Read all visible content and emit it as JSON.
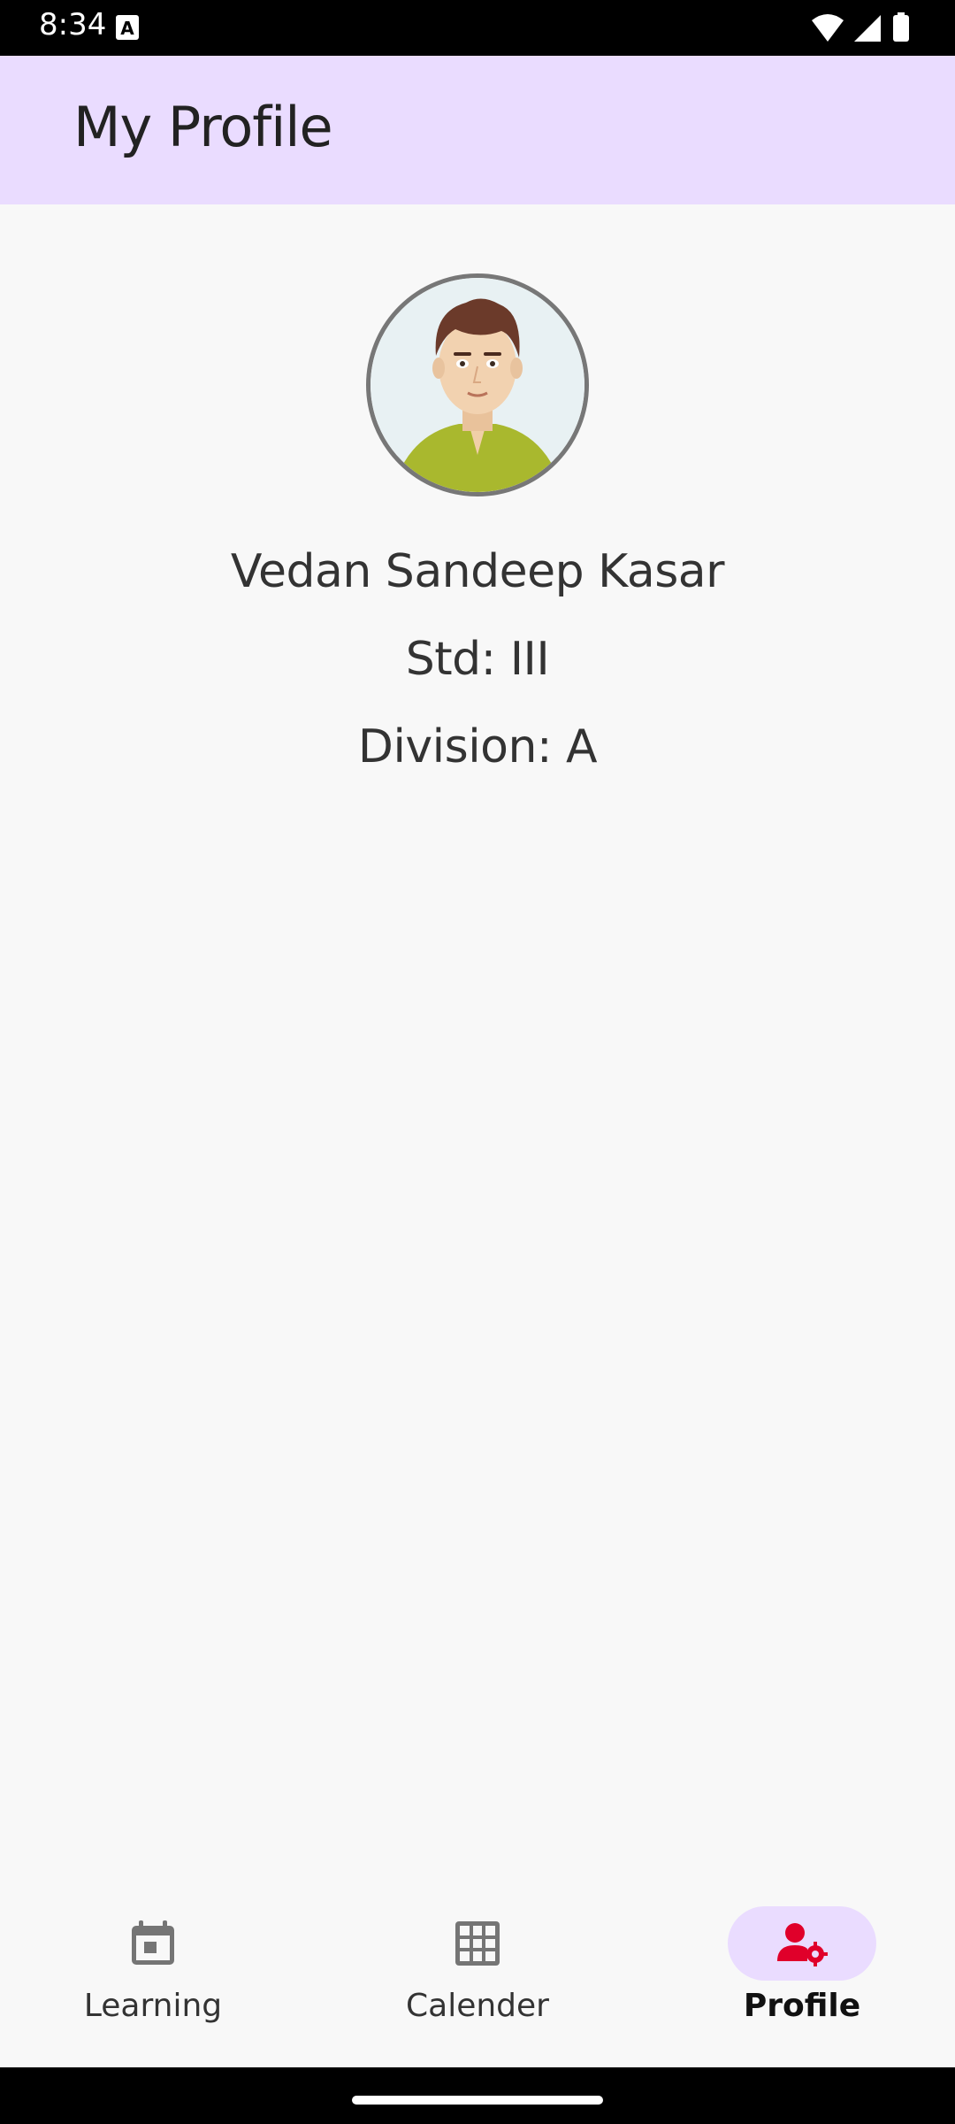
{
  "status_bar": {
    "time": "8:34"
  },
  "app_bar": {
    "title": "My Profile"
  },
  "profile": {
    "name": "Vedan Sandeep Kasar",
    "std": "Std: III",
    "division": "Division: A"
  },
  "bottom_nav": {
    "items": [
      {
        "label": "Learning",
        "icon": "calendar-event-icon",
        "selected": false
      },
      {
        "label": "Calender",
        "icon": "grid-icon",
        "selected": false
      },
      {
        "label": "Profile",
        "icon": "person-gear-icon",
        "selected": true
      }
    ]
  },
  "colors": {
    "app_bar_bg": "#eadcff",
    "selected_icon": "#e0002a",
    "unselected_icon": "#757575"
  }
}
